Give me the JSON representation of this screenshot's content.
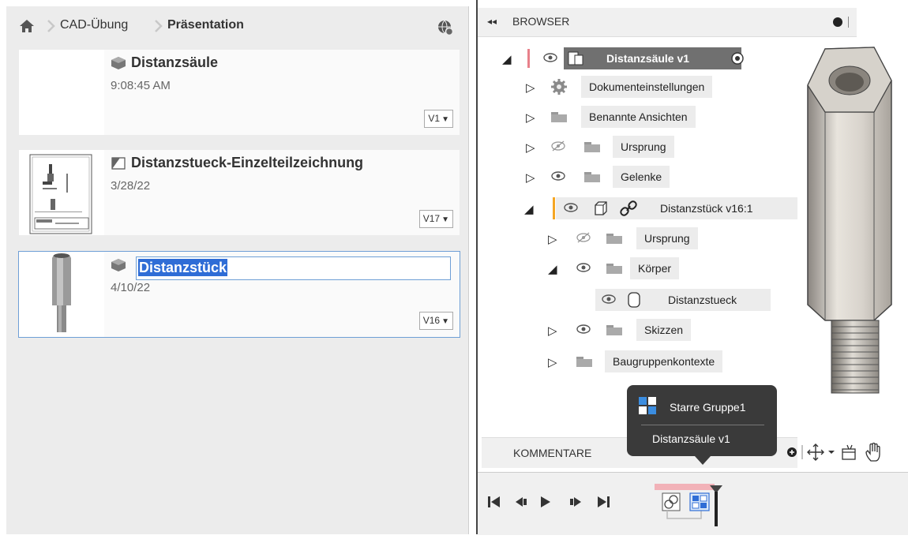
{
  "breadcrumb": {
    "items": [
      "CAD-Übung",
      "Präsentation"
    ]
  },
  "files": [
    {
      "name": "Distanzsäule",
      "date": "9:08:45 AM",
      "version": "V1",
      "icon": "assembly-icon"
    },
    {
      "name": "Distanzstueck-Einzelteilzeichnung",
      "date": "3/28/22",
      "version": "V17",
      "icon": "drawing-icon"
    },
    {
      "name": "Distanzstück",
      "date": "4/10/22",
      "version": "V16",
      "icon": "part-icon",
      "editing": true
    }
  ],
  "browser": {
    "title": "BROWSER",
    "root": "Distanzsäule v1",
    "items": {
      "doc_settings": "Dokumenteinstellungen",
      "named_views": "Benannte Ansichten",
      "origin": "Ursprung",
      "joints": "Gelenke",
      "component": "Distanzstück v16:1",
      "sub_origin": "Ursprung",
      "bodies": "Körper",
      "body": "Distanzstueck",
      "sketches": "Skizzen",
      "contexts": "Baugruppenkontexte"
    }
  },
  "tooltip": {
    "line1": "Starre Gruppe1",
    "line2": "Distanzsäule v1"
  },
  "comments": {
    "label": "KOMMENTARE"
  },
  "colors": {
    "selection": "#2f6dd6",
    "accent_orange": "#f5a623",
    "accent_red": "#e8808a"
  }
}
